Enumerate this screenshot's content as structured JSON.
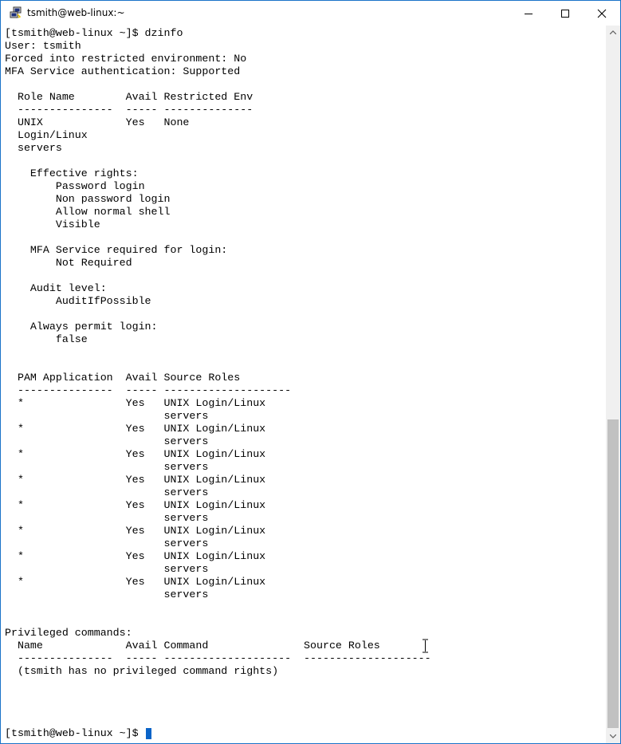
{
  "window": {
    "title": "tsmith@web-linux:~",
    "icon": "putty-icon",
    "controls": [
      "minimize-icon",
      "maximize-icon",
      "close-icon"
    ]
  },
  "terminal": {
    "lines": [
      "[tsmith@web-linux ~]$ dzinfo",
      "User: tsmith",
      "Forced into restricted environment: No",
      "MFA Service authentication: Supported",
      "",
      "  Role Name        Avail Restricted Env",
      "  ---------------  ----- --------------",
      "  UNIX             Yes   None",
      "  Login/Linux",
      "  servers",
      "",
      "    Effective rights:",
      "        Password login",
      "        Non password login",
      "        Allow normal shell",
      "        Visible",
      "",
      "    MFA Service required for login:",
      "        Not Required",
      "",
      "    Audit level:",
      "        AuditIfPossible",
      "",
      "    Always permit login:",
      "        false",
      "",
      "",
      "  PAM Application  Avail Source Roles",
      "  ---------------  ----- --------------------",
      "  *                Yes   UNIX Login/Linux",
      "                         servers",
      "  *                Yes   UNIX Login/Linux",
      "                         servers",
      "  *                Yes   UNIX Login/Linux",
      "                         servers",
      "  *                Yes   UNIX Login/Linux",
      "                         servers",
      "  *                Yes   UNIX Login/Linux",
      "                         servers",
      "  *                Yes   UNIX Login/Linux",
      "                         servers",
      "  *                Yes   UNIX Login/Linux",
      "                         servers",
      "  *                Yes   UNIX Login/Linux",
      "                         servers",
      "",
      "",
      "Privileged commands:",
      "  Name             Avail Command               Source Roles",
      "  ---------------  ----- --------------------  --------------------",
      "  (tsmith has no privileged command rights)"
    ],
    "prompt": "[tsmith@web-linux ~]$ "
  },
  "colors": {
    "window_border": "#1a73c8",
    "cursor": "#0a64c8",
    "text": "#000000",
    "background": "#ffffff",
    "scrollbar_thumb": "#c1c1c1"
  }
}
